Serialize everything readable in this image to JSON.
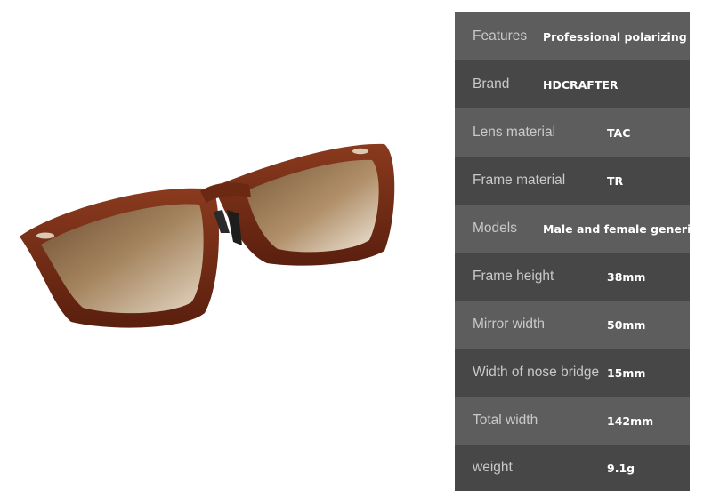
{
  "image": {
    "subject": "glasses-icon"
  },
  "specs": [
    {
      "label": "Features",
      "value": "Professional polarizing"
    },
    {
      "label": "Brand",
      "value": "HDCRAFTER"
    },
    {
      "label": "Lens material",
      "value": "TAC"
    },
    {
      "label": "Frame material",
      "value": "TR"
    },
    {
      "label": "Models",
      "value": "Male and female generic"
    },
    {
      "label": "Frame height",
      "value": "38mm"
    },
    {
      "label": "Mirror width",
      "value": "50mm"
    },
    {
      "label": "Width of nose bridge",
      "value": "15mm"
    },
    {
      "label": "Total width",
      "value": "142mm"
    },
    {
      "label": "weight",
      "value": "9.1g"
    }
  ],
  "colors": {
    "light_row": "#5d5d5d",
    "dark_row": "#474747",
    "frame": "#7a2c16",
    "lens": "#8f6a45"
  }
}
